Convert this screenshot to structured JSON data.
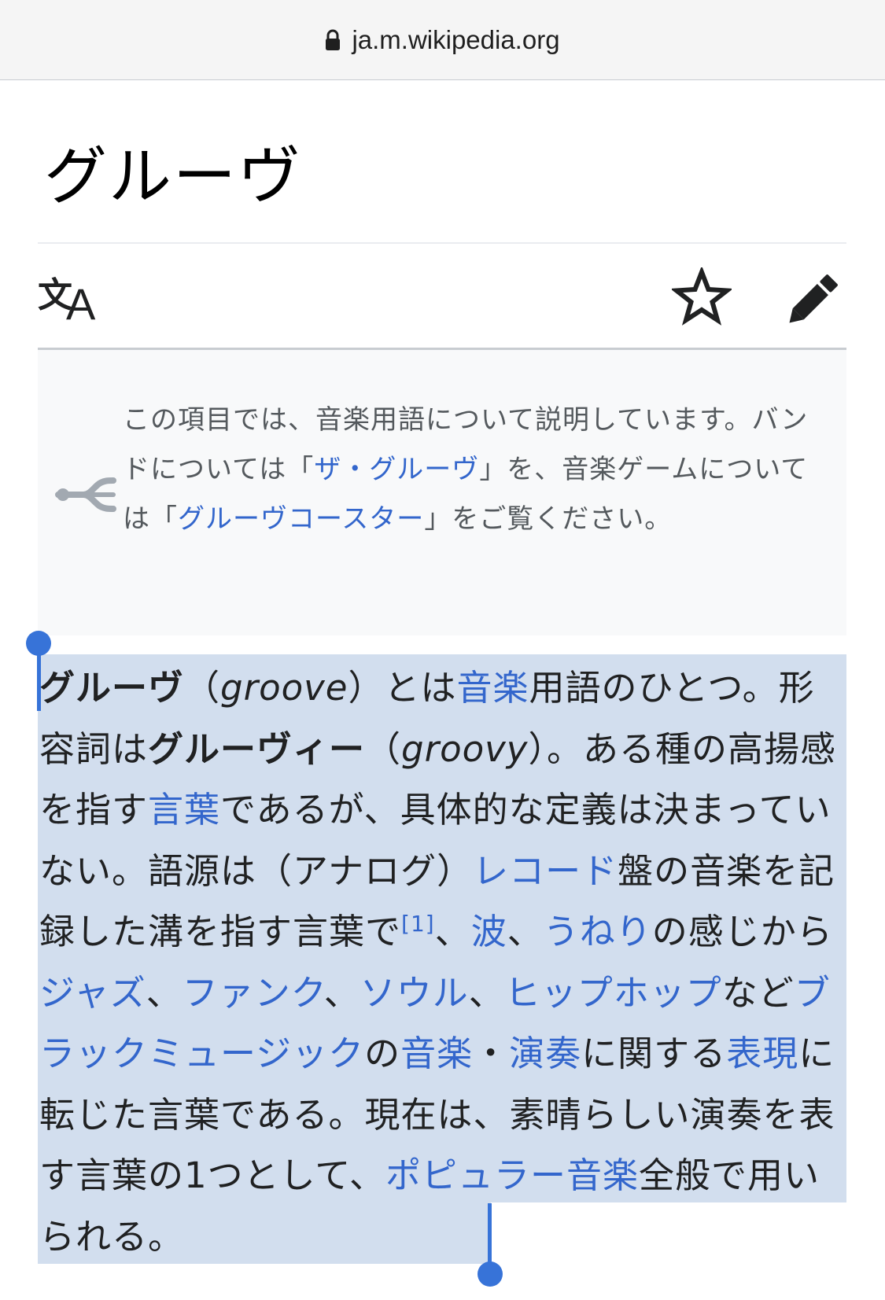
{
  "browser": {
    "url": "ja.m.wikipedia.org"
  },
  "page": {
    "title": "グルーヴ"
  },
  "toolbar": {
    "language_icon": "translate-icon",
    "watch_icon": "star-icon",
    "edit_icon": "pencil-icon"
  },
  "hatnote": {
    "icon": "disambiguation-icon",
    "t1": "この項目では、音楽用語について説明しています。バンドについては「",
    "link1": "ザ・グルーヴ",
    "t2": "」を、音楽ゲームについては「",
    "link2": "グルーヴコースター",
    "t3": "」をご覧ください。"
  },
  "article": {
    "b1": "グルーヴ",
    "t1": "（",
    "i1": "groove",
    "t2": "）とは",
    "l_music1": "音楽",
    "t3": "用語のひとつ。形容詞は",
    "b2": "グルーヴィー",
    "t4": "（",
    "i2": "groovy",
    "t5": "）。ある種の高揚感を指す",
    "l_word": "言葉",
    "t6": "であるが、具体的な定義は決まっていない。語源は（アナログ）",
    "l_record": "レコード",
    "t7": "盤の音楽を記録した溝を指す言葉で",
    "ref1": "[1]",
    "t8": "、",
    "l_wave": "波",
    "t9": "、",
    "l_undulation": "うねり",
    "t10": "の感じから",
    "l_jazz": "ジャズ",
    "t11": "、",
    "l_funk": "ファンク",
    "t12": "、",
    "l_soul": "ソウル",
    "t13": "、",
    "l_hiphop": "ヒップホップ",
    "t14": "など",
    "l_blackmusic": "ブラックミュージック",
    "t15": "の",
    "l_music2": "音楽",
    "t16": "・",
    "l_performance": "演奏",
    "t17": "に関する",
    "l_expression": "表現",
    "t18": "に転じた言葉である。現在は、素晴らしい演奏を表す言葉の1つとして、",
    "l_popular": "ポピュラー音楽",
    "t19": "全般で用いられる。"
  },
  "colors": {
    "link": "#3366cc",
    "selection": "#d2deee",
    "selection_handle": "#3773d8",
    "hatnote_bg": "#f8f9fa"
  }
}
